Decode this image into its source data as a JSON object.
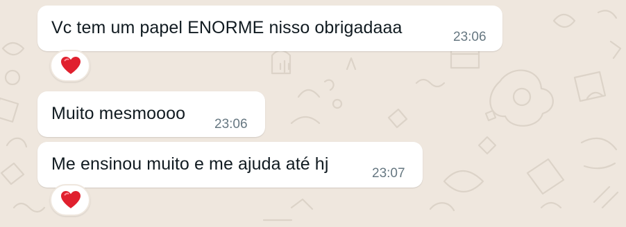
{
  "colors": {
    "wallpaper": "#efe7de",
    "doodle": "#dcd3c8",
    "bubble": "#ffffff",
    "message_text": "#111b21",
    "timestamp": "#667781",
    "heart": "#e0202e"
  },
  "messages": [
    {
      "text": "Vc tem um papel ENORME nisso  obrigadaaa",
      "time": "23:06",
      "reaction": "heart-icon"
    },
    {
      "text": "Muito mesmoooo",
      "time": "23:06"
    },
    {
      "text": "Me ensinou muito e me ajuda até hj",
      "time": "23:07",
      "reaction": "heart-icon"
    }
  ]
}
